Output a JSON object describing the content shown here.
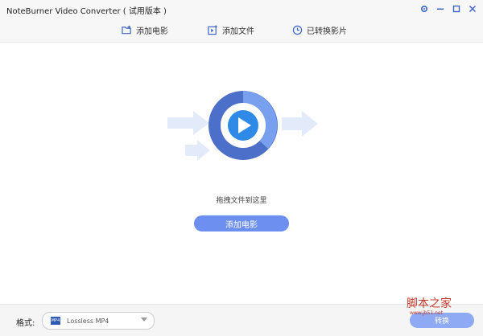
{
  "window": {
    "title": "NoteBurner Video Converter ( 试用版本 )",
    "controls": [
      "settings-icon",
      "minimize-icon",
      "maximize-icon",
      "close-icon"
    ]
  },
  "toolbar": {
    "add_movie": "添加电影",
    "add_file": "添加文件",
    "converted": "已转换影片"
  },
  "main": {
    "hint": "拖拽文件到这里",
    "add_movie_button": "添加电影"
  },
  "footer": {
    "format_label": "格式:",
    "format_value": "Lossless MP4",
    "format_badge": "MP4",
    "convert_button": "转换"
  },
  "watermark": {
    "text": "脚本之家",
    "url": "www.jb51.net"
  },
  "colors": {
    "accent": "#6d8ff0",
    "brand_blue": "#3d64c8",
    "ring_dark": "#4c6fc9",
    "ring_light": "#79a0ee"
  }
}
